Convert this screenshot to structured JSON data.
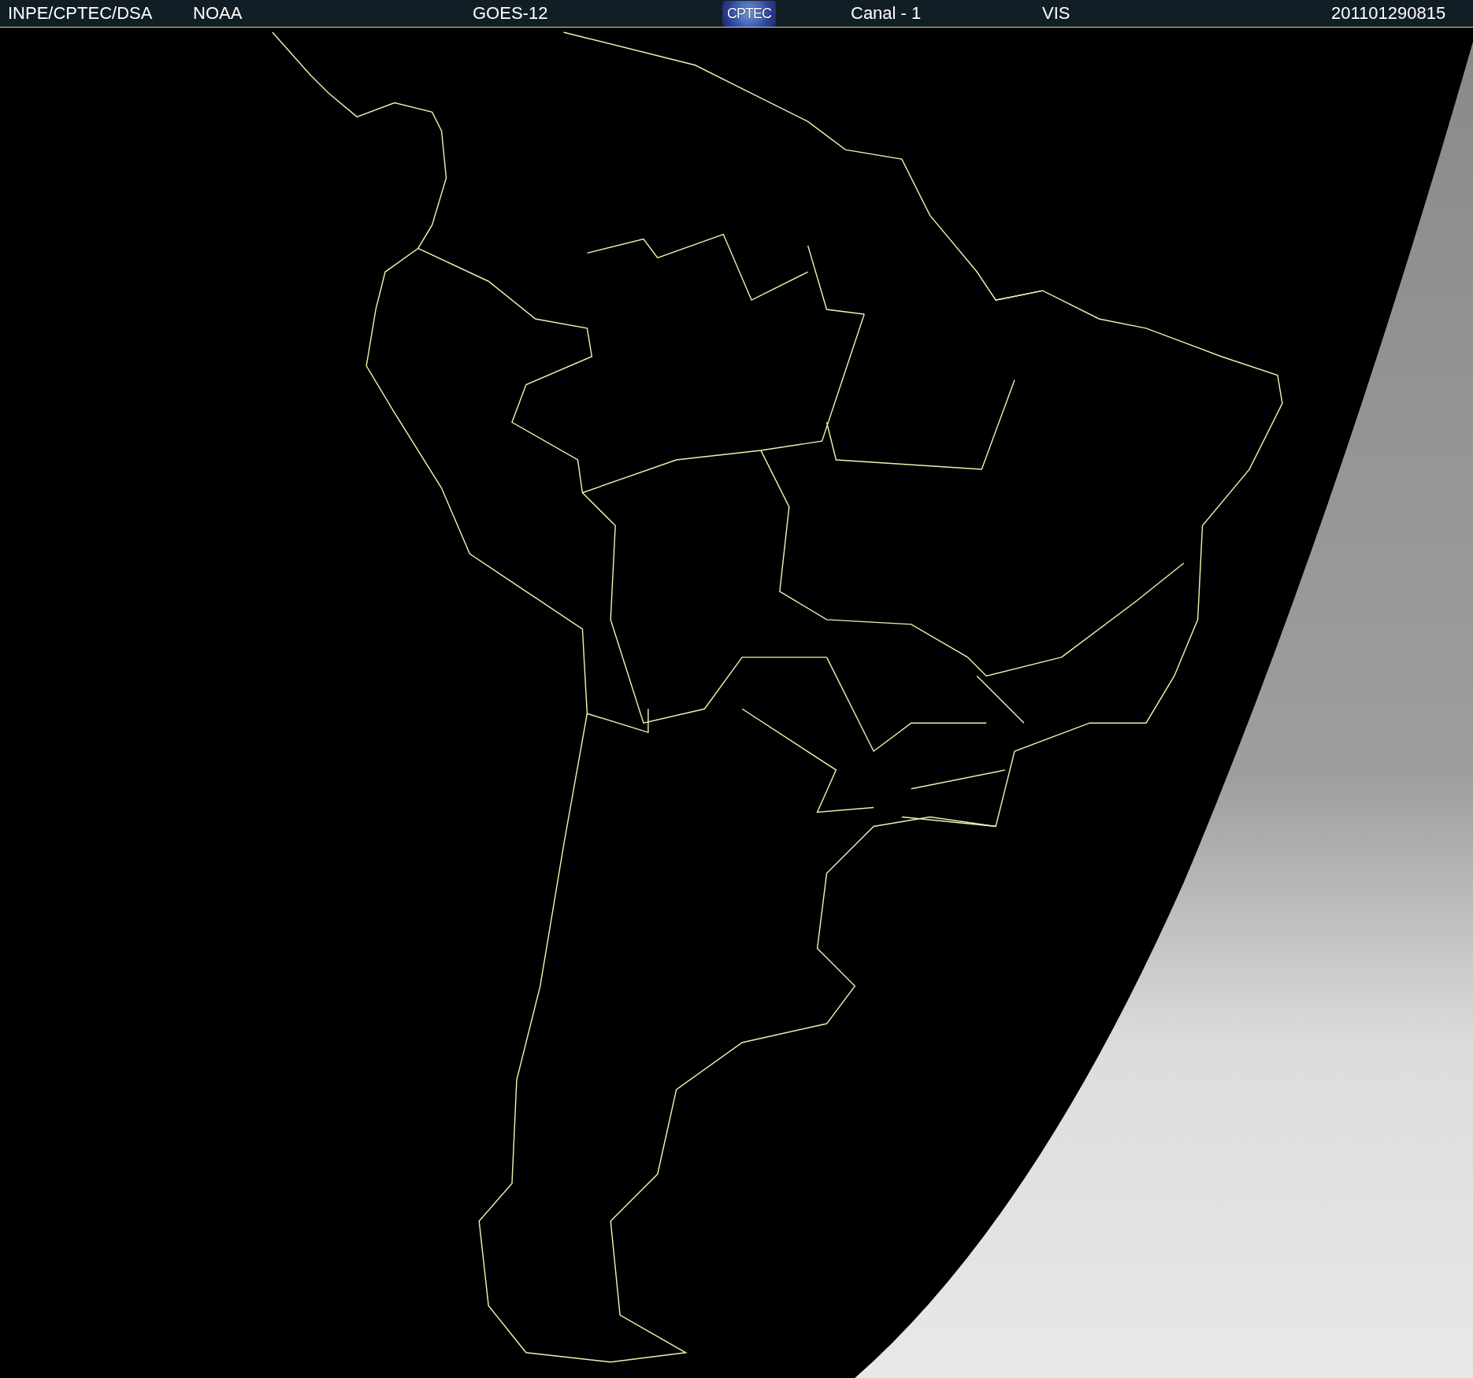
{
  "header": [
    {
      "kind": "text",
      "text": "INPE/CPTEC/DSA"
    },
    {
      "kind": "text",
      "text": "NOAA"
    },
    {
      "kind": "text",
      "text": "GOES-12"
    },
    {
      "kind": "logo",
      "text": "CPTEC"
    },
    {
      "kind": "text",
      "text": "Canal - 1"
    },
    {
      "kind": "text",
      "text": "VIS"
    },
    {
      "kind": "text",
      "text": "201101290815"
    }
  ]
}
